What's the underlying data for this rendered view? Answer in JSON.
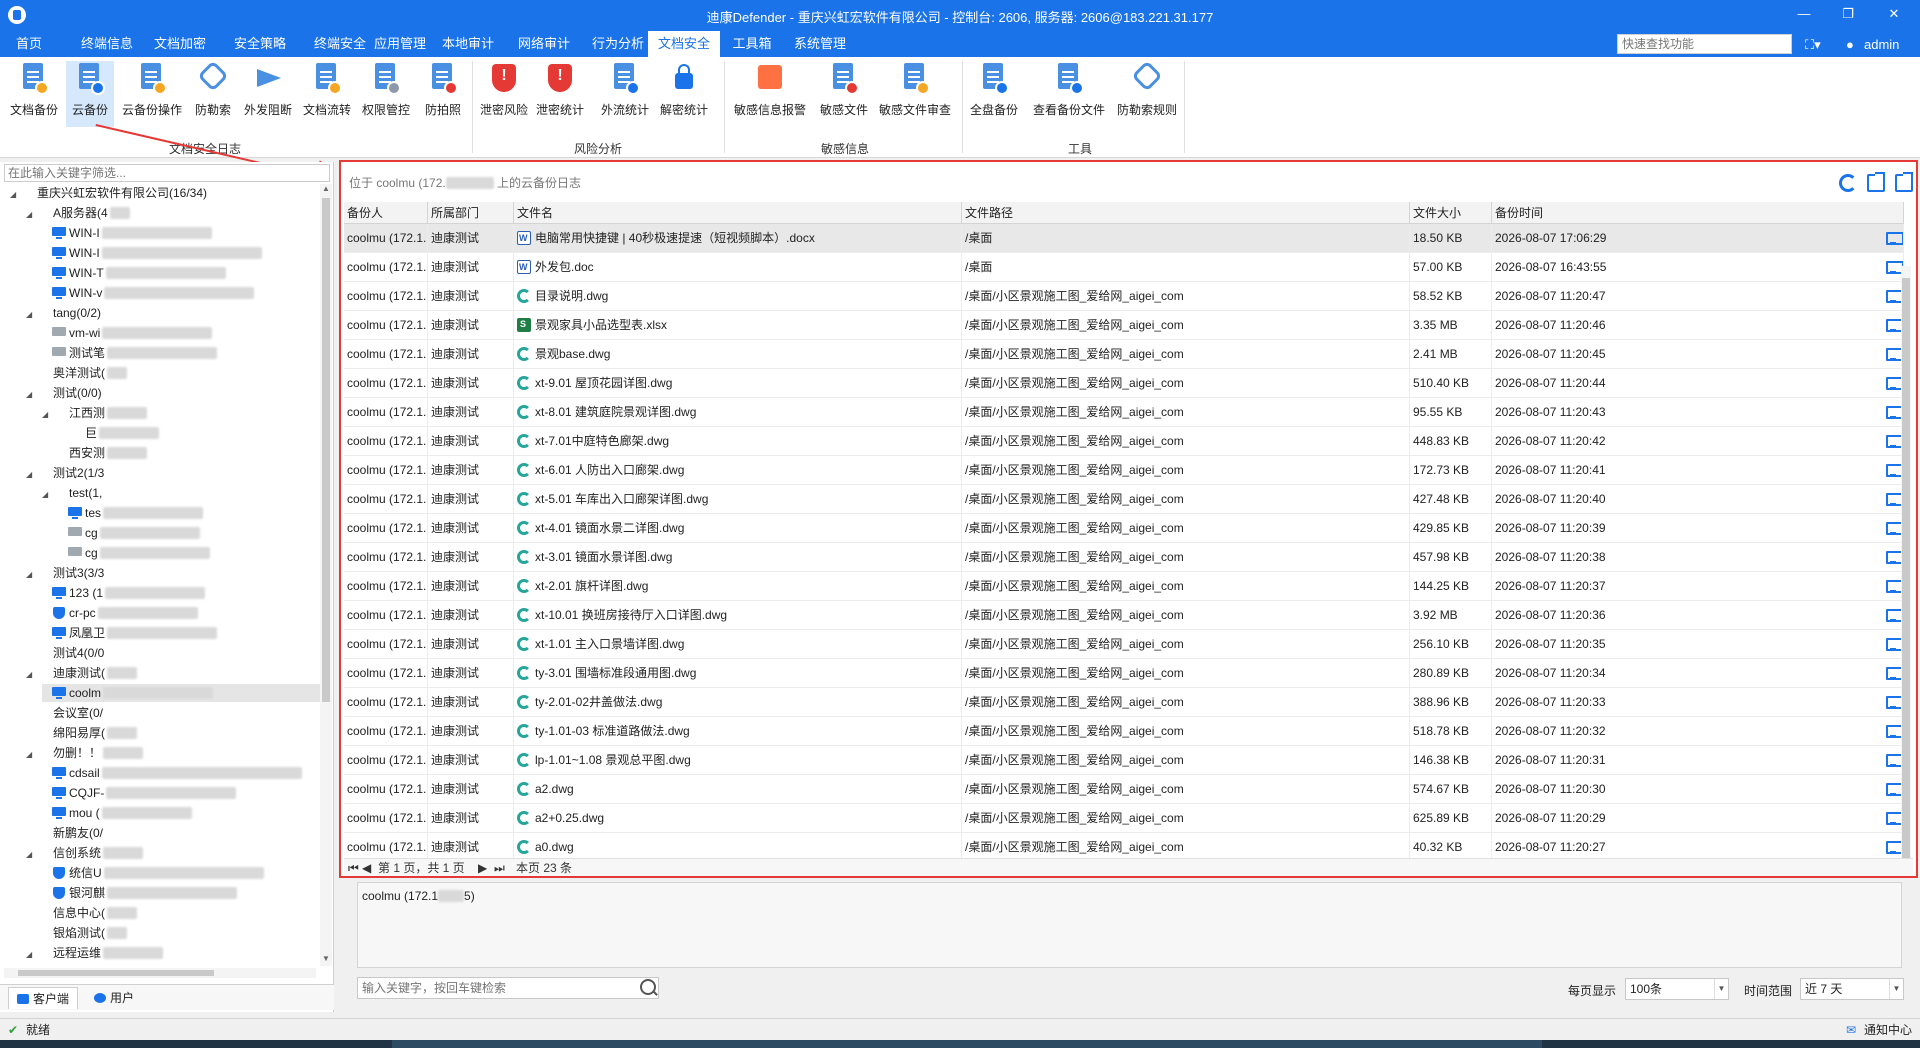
{
  "window": {
    "title": "迪康Defender - 重庆兴虹宏软件有限公司 - 控制台: 2606, 服务器: 2606@183.221.31.177",
    "controls": [
      "—",
      "❐",
      "✕"
    ]
  },
  "menu": {
    "items": [
      "首页",
      "终端信息",
      "文档加密",
      "安全策略",
      "终端安全",
      "应用管理",
      "本地审计",
      "网络审计",
      "行为分析",
      "文档安全",
      "工具箱",
      "系统管理"
    ],
    "active_index": 9,
    "quick_search_placeholder": "快速查找功能",
    "user": "admin"
  },
  "ribbon": {
    "buttons": [
      {
        "label": "文档备份",
        "icon": "doc-backup-icon"
      },
      {
        "label": "云备份",
        "icon": "cloud-backup-icon",
        "active": true
      },
      {
        "label": "云备份操作",
        "icon": "cloud-backup-op-icon"
      },
      {
        "label": "防勒索",
        "icon": "anti-ransom-icon"
      },
      {
        "label": "外发阻断",
        "icon": "send-block-icon"
      },
      {
        "label": "文档流转",
        "icon": "doc-flow-icon"
      },
      {
        "label": "权限管控",
        "icon": "permission-icon"
      },
      {
        "label": "防拍照",
        "icon": "anti-photo-icon"
      },
      {
        "label": "泄密风险",
        "icon": "leak-risk-icon"
      },
      {
        "label": "泄密统计",
        "icon": "leak-stats-icon"
      },
      {
        "label": "外流统计",
        "icon": "outflow-stats-icon"
      },
      {
        "label": "解密统计",
        "icon": "decrypt-stats-icon"
      },
      {
        "label": "敏感信息报警",
        "icon": "sensitive-alert-icon"
      },
      {
        "label": "敏感文件",
        "icon": "sensitive-file-icon"
      },
      {
        "label": "敏感文件审查",
        "icon": "sensitive-review-icon"
      },
      {
        "label": "全盘备份",
        "icon": "full-backup-icon"
      },
      {
        "label": "查看备份文件",
        "icon": "view-backup-icon"
      },
      {
        "label": "防勒索规则",
        "icon": "ransom-rule-icon"
      }
    ],
    "groups": [
      "文档安全日志",
      "风险分析",
      "敏感信息",
      "工具"
    ]
  },
  "tree": {
    "filter_placeholder": "在此输入关键字筛选...",
    "nodes": [
      {
        "text": "重庆兴虹宏软件有限公司(16/34)",
        "icon": "group",
        "level": 0,
        "toggle": "▲"
      },
      {
        "text": "A服务器(4",
        "icon": "group",
        "level": 1,
        "toggle": "▲",
        "blur": 20
      },
      {
        "text": "WIN-I",
        "icon": "pc",
        "level": 2,
        "blur": 110
      },
      {
        "text": "WIN-I",
        "icon": "pc",
        "level": 2,
        "blur": 160
      },
      {
        "text": "WIN-T",
        "icon": "pc",
        "level": 2,
        "blur": 120
      },
      {
        "text": "WIN-v",
        "icon": "pc",
        "level": 2,
        "blur": 150
      },
      {
        "text": "tang(0/2)",
        "icon": "group",
        "level": 1,
        "toggle": "▲"
      },
      {
        "text": "vm-wi",
        "icon": "pcg",
        "level": 2,
        "blur": 110
      },
      {
        "text": "测试笔",
        "icon": "pcg",
        "level": 2,
        "blur": 110
      },
      {
        "text": "奥洋测试(",
        "icon": "group",
        "level": 1,
        "blur": 20
      },
      {
        "text": "测试(0/0)",
        "icon": "group",
        "level": 1,
        "toggle": "▲"
      },
      {
        "text": "江西测",
        "icon": "group",
        "level": 2,
        "toggle": "▲",
        "blur": 40
      },
      {
        "text": "巨",
        "icon": "group",
        "level": 3,
        "blur": 60
      },
      {
        "text": "西安测",
        "icon": "group",
        "level": 2,
        "blur": 40
      },
      {
        "text": "测试2(1/3",
        "icon": "group",
        "level": 1,
        "toggle": "▲"
      },
      {
        "text": "test(1,",
        "icon": "group",
        "level": 2,
        "toggle": "▲"
      },
      {
        "text": "tes",
        "icon": "pc",
        "level": 3,
        "blur": 100
      },
      {
        "text": "cg",
        "icon": "pcg",
        "level": 3,
        "blur": 100
      },
      {
        "text": "cg",
        "icon": "pcg",
        "level": 3,
        "blur": 110
      },
      {
        "text": "测试3(3/3",
        "icon": "group",
        "level": 1,
        "toggle": "▲"
      },
      {
        "text": "123 (1",
        "icon": "pc",
        "level": 2,
        "blur": 100
      },
      {
        "text": "cr-pc",
        "icon": "pcs",
        "level": 2,
        "blur": 100
      },
      {
        "text": "凤凰卫",
        "icon": "pc",
        "level": 2,
        "blur": 110
      },
      {
        "text": "测试4(0/0",
        "icon": "group",
        "level": 1
      },
      {
        "text": "迪康测试(",
        "icon": "group",
        "level": 1,
        "toggle": "▲",
        "blur": 30
      },
      {
        "text": "coolm",
        "icon": "pc",
        "level": 2,
        "blur": 110,
        "selected": true
      },
      {
        "text": "会议室(0/",
        "icon": "group",
        "level": 1
      },
      {
        "text": "绵阳易厚(",
        "icon": "group",
        "level": 1,
        "blur": 30
      },
      {
        "text": "勿删！！",
        "icon": "group",
        "level": 1,
        "toggle": "▲",
        "blur": 40
      },
      {
        "text": "cdsail",
        "icon": "pc",
        "level": 2,
        "blur": 200
      },
      {
        "text": "CQJF-",
        "icon": "pc",
        "level": 2,
        "blur": 130
      },
      {
        "text": "mou (",
        "icon": "pc",
        "level": 2,
        "blur": 90
      },
      {
        "text": "新鹏友(0/",
        "icon": "group",
        "level": 1
      },
      {
        "text": "信创系统",
        "icon": "group",
        "level": 1,
        "toggle": "▲",
        "blur": 40
      },
      {
        "text": "统信U",
        "icon": "pcs",
        "level": 2,
        "blur": 160
      },
      {
        "text": "银河麒",
        "icon": "pcs",
        "level": 2,
        "blur": 130
      },
      {
        "text": "信息中心(",
        "icon": "group",
        "level": 1,
        "blur": 30
      },
      {
        "text": "银焰测试(",
        "icon": "group",
        "level": 1,
        "blur": 20
      },
      {
        "text": "远程运维",
        "icon": "group",
        "level": 1,
        "toggle": "▲",
        "blur": 60
      }
    ],
    "tabs": [
      "客户端",
      "用户"
    ]
  },
  "main": {
    "path_text": "位于 coolmu (172.",
    "path_suffix": " 上的云备份日志",
    "columns": [
      "备份人",
      "所属部门",
      "文件名",
      "文件路径",
      "文件大小",
      "备份时间"
    ],
    "rows": [
      {
        "user": "coolmu (172.1...",
        "dept": "迪康测试",
        "name": "电脑常用快捷键 | 40秒极速提速（短视频脚本）.docx",
        "type": "docx",
        "path": "/桌面",
        "size": "18.50 KB",
        "time": "2026-08-07 17:06:29"
      },
      {
        "user": "coolmu (172.1...",
        "dept": "迪康测试",
        "name": "外发包.doc",
        "type": "doc",
        "path": "/桌面",
        "size": "57.00 KB",
        "time": "2026-08-07 16:43:55"
      },
      {
        "user": "coolmu (172.1...",
        "dept": "迪康测试",
        "name": "目录说明.dwg",
        "type": "dwg",
        "path": "/桌面/小区景观施工图_爱给网_aigei_com",
        "size": "58.52 KB",
        "time": "2026-08-07 11:20:47"
      },
      {
        "user": "coolmu (172.1...",
        "dept": "迪康测试",
        "name": "景观家具小品选型表.xlsx",
        "type": "xlsx",
        "path": "/桌面/小区景观施工图_爱给网_aigei_com",
        "size": "3.35 MB",
        "time": "2026-08-07 11:20:46"
      },
      {
        "user": "coolmu (172.1...",
        "dept": "迪康测试",
        "name": "景观base.dwg",
        "type": "dwg",
        "path": "/桌面/小区景观施工图_爱给网_aigei_com",
        "size": "2.41 MB",
        "time": "2026-08-07 11:20:45"
      },
      {
        "user": "coolmu (172.1...",
        "dept": "迪康测试",
        "name": "xt-9.01 屋顶花园详图.dwg",
        "type": "dwg",
        "path": "/桌面/小区景观施工图_爱给网_aigei_com",
        "size": "510.40 KB",
        "time": "2026-08-07 11:20:44"
      },
      {
        "user": "coolmu (172.1...",
        "dept": "迪康测试",
        "name": "xt-8.01 建筑庭院景观详图.dwg",
        "type": "dwg",
        "path": "/桌面/小区景观施工图_爱给网_aigei_com",
        "size": "95.55 KB",
        "time": "2026-08-07 11:20:43"
      },
      {
        "user": "coolmu (172.1...",
        "dept": "迪康测试",
        "name": "xt-7.01中庭特色廊架.dwg",
        "type": "dwg",
        "path": "/桌面/小区景观施工图_爱给网_aigei_com",
        "size": "448.83 KB",
        "time": "2026-08-07 11:20:42"
      },
      {
        "user": "coolmu (172.1...",
        "dept": "迪康测试",
        "name": "xt-6.01 人防出入口廊架.dwg",
        "type": "dwg",
        "path": "/桌面/小区景观施工图_爱给网_aigei_com",
        "size": "172.73 KB",
        "time": "2026-08-07 11:20:41"
      },
      {
        "user": "coolmu (172.1...",
        "dept": "迪康测试",
        "name": "xt-5.01 车库出入口廊架详图.dwg",
        "type": "dwg",
        "path": "/桌面/小区景观施工图_爱给网_aigei_com",
        "size": "427.48 KB",
        "time": "2026-08-07 11:20:40"
      },
      {
        "user": "coolmu (172.1...",
        "dept": "迪康测试",
        "name": "xt-4.01 镜面水景二详图.dwg",
        "type": "dwg",
        "path": "/桌面/小区景观施工图_爱给网_aigei_com",
        "size": "429.85 KB",
        "time": "2026-08-07 11:20:39"
      },
      {
        "user": "coolmu (172.1...",
        "dept": "迪康测试",
        "name": "xt-3.01 镜面水景详图.dwg",
        "type": "dwg",
        "path": "/桌面/小区景观施工图_爱给网_aigei_com",
        "size": "457.98 KB",
        "time": "2026-08-07 11:20:38"
      },
      {
        "user": "coolmu (172.1...",
        "dept": "迪康测试",
        "name": "xt-2.01 旗杆详图.dwg",
        "type": "dwg",
        "path": "/桌面/小区景观施工图_爱给网_aigei_com",
        "size": "144.25 KB",
        "time": "2026-08-07 11:20:37"
      },
      {
        "user": "coolmu (172.1...",
        "dept": "迪康测试",
        "name": "xt-10.01 换班房接待厅入口详图.dwg",
        "type": "dwg",
        "path": "/桌面/小区景观施工图_爱给网_aigei_com",
        "size": "3.92 MB",
        "time": "2026-08-07 11:20:36"
      },
      {
        "user": "coolmu (172.1...",
        "dept": "迪康测试",
        "name": "xt-1.01 主入口景墙详图.dwg",
        "type": "dwg",
        "path": "/桌面/小区景观施工图_爱给网_aigei_com",
        "size": "256.10 KB",
        "time": "2026-08-07 11:20:35"
      },
      {
        "user": "coolmu (172.1...",
        "dept": "迪康测试",
        "name": "ty-3.01 围墙标准段通用图.dwg",
        "type": "dwg",
        "path": "/桌面/小区景观施工图_爱给网_aigei_com",
        "size": "280.89 KB",
        "time": "2026-08-07 11:20:34"
      },
      {
        "user": "coolmu (172.1...",
        "dept": "迪康测试",
        "name": "ty-2.01-02井盖做法.dwg",
        "type": "dwg",
        "path": "/桌面/小区景观施工图_爱给网_aigei_com",
        "size": "388.96 KB",
        "time": "2026-08-07 11:20:33"
      },
      {
        "user": "coolmu (172.1...",
        "dept": "迪康测试",
        "name": "ty-1.01-03 标准道路做法.dwg",
        "type": "dwg",
        "path": "/桌面/小区景观施工图_爱给网_aigei_com",
        "size": "518.78 KB",
        "time": "2026-08-07 11:20:32"
      },
      {
        "user": "coolmu (172.1...",
        "dept": "迪康测试",
        "name": "lp-1.01~1.08 景观总平图.dwg",
        "type": "dwg",
        "path": "/桌面/小区景观施工图_爱给网_aigei_com",
        "size": "146.38 KB",
        "time": "2026-08-07 11:20:31"
      },
      {
        "user": "coolmu (172.1...",
        "dept": "迪康测试",
        "name": "a2.dwg",
        "type": "dwg",
        "path": "/桌面/小区景观施工图_爱给网_aigei_com",
        "size": "574.67 KB",
        "time": "2026-08-07 11:20:30"
      },
      {
        "user": "coolmu (172.1...",
        "dept": "迪康测试",
        "name": "a2+0.25.dwg",
        "type": "dwg",
        "path": "/桌面/小区景观施工图_爱给网_aigei_com",
        "size": "625.89 KB",
        "time": "2026-08-07 11:20:29"
      },
      {
        "user": "coolmu (172.1...",
        "dept": "迪康测试",
        "name": "a0.dwg",
        "type": "dwg",
        "path": "/桌面/小区景观施工图_爱给网_aigei_com",
        "size": "40.32 KB",
        "time": "2026-08-07 11:20:27"
      }
    ],
    "pager": {
      "nav_first": "⏮",
      "nav_prev": "◀",
      "page_info": "第 1 页，共 1 页",
      "nav_next": "▶",
      "nav_last": "⏭",
      "count_info": "本页 23 条"
    }
  },
  "detail": {
    "text": "coolmu (172.1",
    "suffix": "5)"
  },
  "bottom": {
    "search_placeholder": "输入关键字，按回车键检索",
    "per_page_label": "每页显示",
    "per_page_value": "100条",
    "range_label": "时间范围",
    "range_value": "近 7 天"
  },
  "status": {
    "text": "就绪",
    "notify": "通知中心"
  }
}
